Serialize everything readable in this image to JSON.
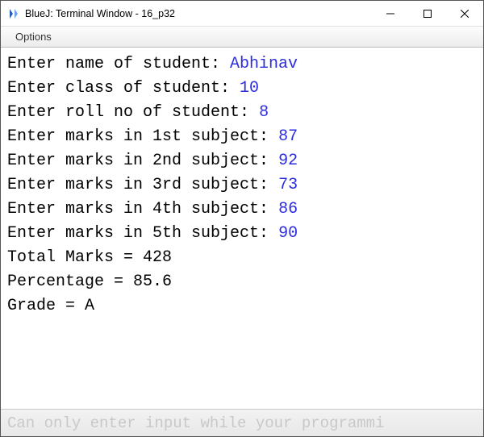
{
  "window": {
    "title": "BlueJ: Terminal Window - 16_p32"
  },
  "menubar": {
    "options": "Options"
  },
  "terminal": {
    "lines": [
      {
        "prompt": "Enter name of student: ",
        "input": "Abhinav"
      },
      {
        "prompt": "Enter class of student: ",
        "input": "10"
      },
      {
        "prompt": "Enter roll no of student: ",
        "input": "8"
      },
      {
        "prompt": "Enter marks in 1st subject: ",
        "input": "87"
      },
      {
        "prompt": "Enter marks in 2nd subject: ",
        "input": "92"
      },
      {
        "prompt": "Enter marks in 3rd subject: ",
        "input": "73"
      },
      {
        "prompt": "Enter marks in 4th subject: ",
        "input": "86"
      },
      {
        "prompt": "Enter marks in 5th subject: ",
        "input": "90"
      },
      {
        "prompt": "Total Marks = 428",
        "input": ""
      },
      {
        "prompt": "Percentage = 85.6",
        "input": ""
      },
      {
        "prompt": "Grade = A",
        "input": ""
      }
    ]
  },
  "inputbar": {
    "placeholder": "Can only enter input while your programmi"
  }
}
